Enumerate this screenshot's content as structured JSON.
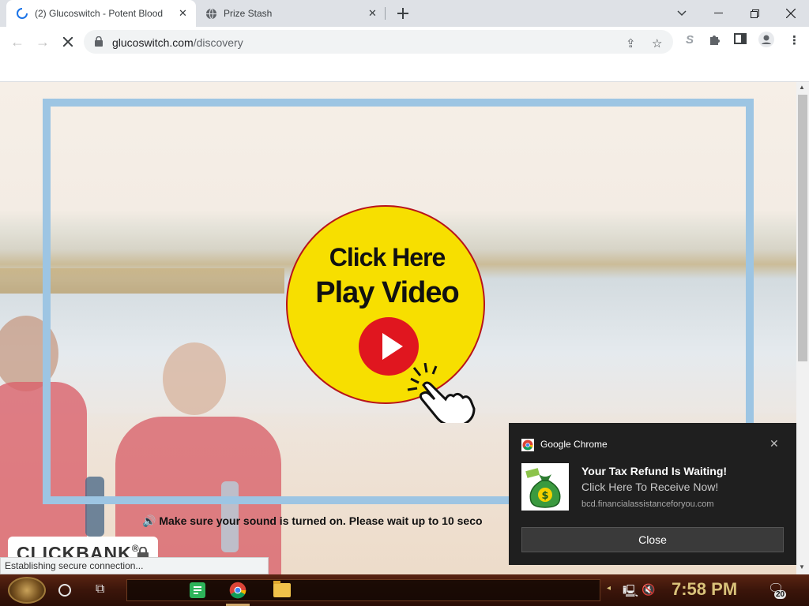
{
  "browser": {
    "tabs": [
      {
        "title": "(2) Glucoswitch - Potent Blood",
        "active": true
      },
      {
        "title": "Prize Stash",
        "active": false
      }
    ],
    "new_tab_icon": "plus-icon",
    "address": {
      "domain": "glucoswitch.com",
      "path": "/discovery"
    }
  },
  "page": {
    "play_line1": "Click Here",
    "play_line2": "Play Video",
    "sound_message": "Make sure your sound is turned on. Please wait up to 10 seco",
    "clickbank_label": "CLICKBANK",
    "status_text": "Establishing secure connection..."
  },
  "notification": {
    "app": "Google Chrome",
    "title": "Your Tax Refund Is Waiting!",
    "body": "Click Here To Receive Now!",
    "domain": "bcd.financialassistanceforyou.com",
    "close_label": "Close"
  },
  "taskbar": {
    "time": "7:58 PM",
    "notification_count": "20"
  },
  "colors": {
    "circle_fill": "#f7df00",
    "play_red": "#e0161f",
    "frame_blue": "#9dc5e3"
  }
}
